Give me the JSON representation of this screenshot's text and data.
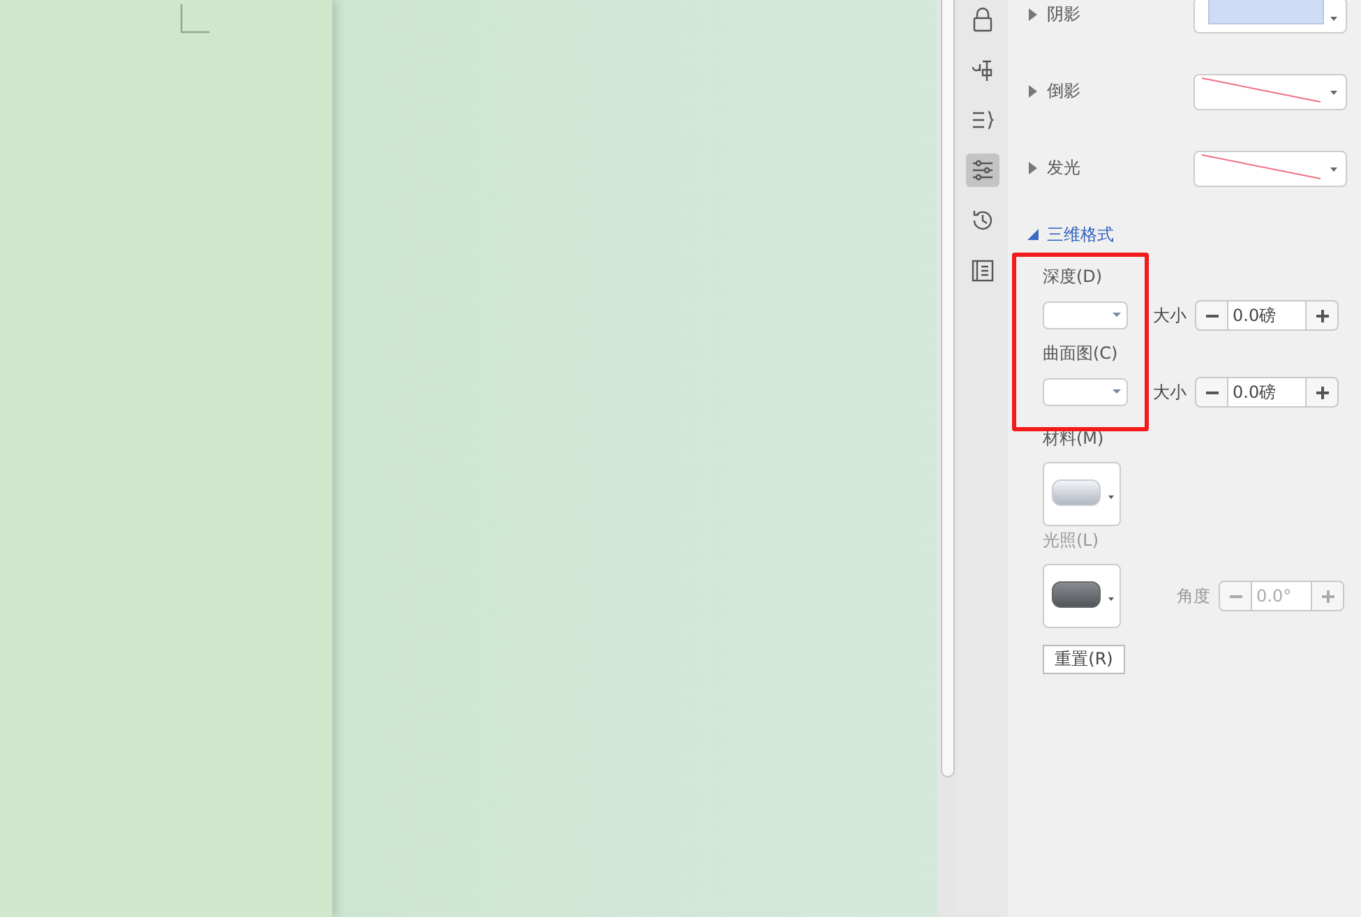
{
  "sidebar": {
    "items": [
      {
        "kind": "lock",
        "selected": false
      },
      {
        "kind": "translate",
        "selected": false
      },
      {
        "kind": "outline",
        "selected": false
      },
      {
        "kind": "sliders",
        "selected": true
      },
      {
        "kind": "history",
        "selected": false
      },
      {
        "kind": "form",
        "selected": false
      }
    ]
  },
  "effects": [
    {
      "label": "阴影",
      "expanded": false,
      "kind": "shadow"
    },
    {
      "label": "倒影",
      "expanded": false,
      "kind": "none"
    },
    {
      "label": "发光",
      "expanded": false,
      "kind": "none"
    }
  ],
  "format_3d": {
    "title": "三维格式",
    "expanded": true,
    "highlighted": true,
    "bevels": [
      {
        "label": "深度(D)",
        "size_label": "大小",
        "value": "0.0磅"
      },
      {
        "label": "曲面图(C)",
        "size_label": "大小",
        "value": "0.0磅"
      }
    ],
    "material": {
      "label": "材料(M)",
      "disabled": false
    },
    "lighting": {
      "label": "光照(L)",
      "disabled": true
    },
    "angle": {
      "label": "角度",
      "value": "0.0°",
      "disabled": true
    },
    "reset_button": "重置(R)"
  }
}
